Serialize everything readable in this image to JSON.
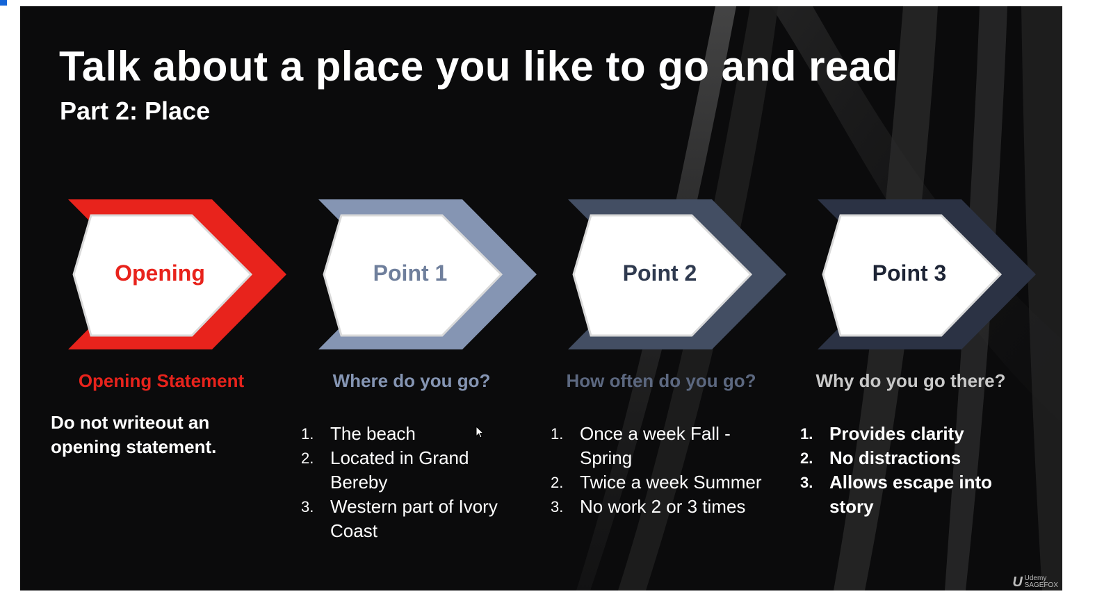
{
  "slide": {
    "title": "Talk about a place you like to go and read",
    "subtitle": "Part 2: Place"
  },
  "steps": [
    {
      "label": "Opening",
      "question": "Opening Statement",
      "accent": "#e8231c",
      "label_color": "#e8231c",
      "note": "Do not writeout an opening statement."
    },
    {
      "label": "Point 1",
      "question": "Where do you go?",
      "accent": "#8595b3",
      "label_color": "#6f7f9c",
      "points": [
        {
          "num": "1.",
          "text": "The beach"
        },
        {
          "num": "2.",
          "text": "Located in Grand Bereby"
        },
        {
          "num": "3.",
          "text": "Western part of Ivory Coast"
        }
      ]
    },
    {
      "label": "Point 2",
      "question": "How often do you go?",
      "accent": "#434e63",
      "label_color": "#2f3a4f",
      "points": [
        {
          "num": "1.",
          "text": "Once a week Fall - Spring"
        },
        {
          "num": "2.",
          "text": "Twice a week Summer"
        },
        {
          "num": "3.",
          "text": "No work 2 or 3 times"
        }
      ]
    },
    {
      "label": "Point 3",
      "question": "Why do you go there?",
      "accent": "#2b3244",
      "label_color": "#1d2435",
      "points": [
        {
          "num": "1.",
          "text": "Provides clarity"
        },
        {
          "num": "2.",
          "text": "No distractions"
        },
        {
          "num": "3.",
          "text": "Allows escape into story"
        }
      ]
    }
  ],
  "watermark": {
    "logo": "U",
    "line1": "Udemy",
    "line2": "SAGEFOX"
  },
  "icons": {
    "cursor": "mouse-pointer-icon"
  }
}
